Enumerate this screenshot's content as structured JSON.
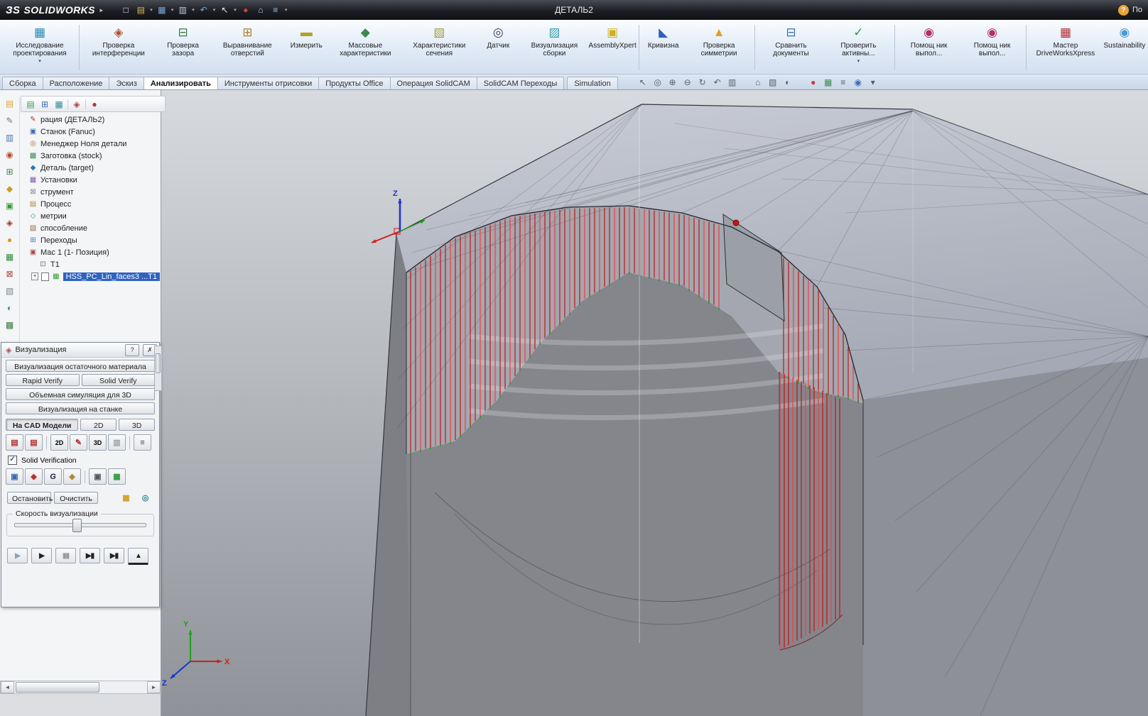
{
  "colors": {
    "selection_blue": "#2f63c0",
    "toolpath_red": "#cc2222",
    "toolpath_green": "#1e9e1e",
    "titlebar_dark": "#1c1e23",
    "ribbon_blue": "#d3e0f0"
  },
  "glyphs": {
    "caret": "▾",
    "logo_caret": "►",
    "question": "?",
    "close": "✗",
    "check": "✓",
    "left": "◄",
    "right": "►",
    "plus": "+"
  },
  "titlebar": {
    "logo_mark": "ЗS",
    "logo_text": "SOLIDWORKS",
    "title": "ДЕТАЛЬ2",
    "right_text": "По",
    "help": "?",
    "icons": [
      {
        "name": "new-document-icon",
        "glyph": "□"
      },
      {
        "name": "open-icon",
        "glyph": "▤"
      },
      {
        "name": "save-icon",
        "glyph": "▦"
      },
      {
        "name": "print-icon",
        "glyph": "▥"
      },
      {
        "name": "undo-icon",
        "glyph": "↶"
      },
      {
        "name": "select-icon",
        "glyph": "↖"
      },
      {
        "name": "rebuild-icon",
        "glyph": "●"
      },
      {
        "name": "home-icon",
        "glyph": "⌂"
      },
      {
        "name": "options-icon",
        "glyph": "≡"
      }
    ]
  },
  "ribbon": {
    "buttons": [
      {
        "label": "Исследование проектирования",
        "icon": "▦",
        "dropdown": true
      },
      {
        "label": "Проверка интерференции",
        "icon": "◈"
      },
      {
        "label": "Проверка зазора",
        "icon": "⊟"
      },
      {
        "label": "Выравнивание отверстий",
        "icon": "⊞"
      },
      {
        "label": "Измерить",
        "icon": "▬"
      },
      {
        "label": "Массовые характеристики",
        "icon": "◆"
      },
      {
        "label": "Характеристики сечения",
        "icon": "▧"
      },
      {
        "label": "Датчик",
        "icon": "◎"
      },
      {
        "label": "Визуализация сборки",
        "icon": "▨"
      },
      {
        "label": "AssemblyXpert",
        "icon": "▣"
      },
      {
        "label": "Кривизна",
        "icon": "◣"
      },
      {
        "label": "Проверка симметрии",
        "icon": "▲"
      },
      {
        "label": "Сравнить документы",
        "icon": "⊟"
      },
      {
        "label": "Проверить активны...",
        "icon": "✓",
        "dropdown": true
      },
      {
        "label": "Помощ ник выпол...",
        "icon": "◉"
      },
      {
        "label": "Помощ ник выпол...",
        "icon": "◉"
      },
      {
        "label": "Мастер DriveWorksXpress",
        "icon": "▦"
      },
      {
        "label": "Sustainability",
        "icon": "◉"
      }
    ]
  },
  "tabs": {
    "items": [
      {
        "label": "Сборка"
      },
      {
        "label": "Расположение"
      },
      {
        "label": "Эскиз"
      },
      {
        "label": "Анализировать",
        "active": true
      },
      {
        "label": "Инструменты отрисовки"
      },
      {
        "label": "Продукты Office"
      },
      {
        "label": "Операция  SolidCAM"
      },
      {
        "label": "SolidCAM Переходы"
      },
      {
        "label": "Simulation"
      }
    ]
  },
  "hud": {
    "icons": [
      {
        "name": "select-icon",
        "glyph": "↖"
      },
      {
        "name": "zoom-fit-icon",
        "glyph": "◎"
      },
      {
        "name": "zoom-in-icon",
        "glyph": "⊕"
      },
      {
        "name": "zoom-out-icon",
        "glyph": "⊖"
      },
      {
        "name": "rotate-view-icon",
        "glyph": "↻"
      },
      {
        "name": "previous-view-icon",
        "glyph": "↶"
      },
      {
        "name": "section-view-icon",
        "glyph": "▥"
      },
      {
        "name": "view-orientation-icon",
        "glyph": "⌂"
      },
      {
        "name": "display-style-icon",
        "glyph": "▧"
      },
      {
        "name": "hide-show-icon",
        "glyph": "◐"
      },
      {
        "name": "appearance-icon",
        "glyph": "●"
      },
      {
        "name": "scene-icon",
        "glyph": "▦"
      },
      {
        "name": "view-settings-icon",
        "glyph": "≡"
      },
      {
        "name": "camera-icon",
        "glyph": "◉"
      },
      {
        "name": "hud-caret-icon",
        "glyph": "▾"
      }
    ]
  },
  "side_strip": {
    "icons": [
      {
        "name": "folder-icon",
        "glyph": "▤"
      },
      {
        "name": "attach-icon",
        "glyph": "✎"
      },
      {
        "name": "views-icon",
        "glyph": "▥"
      },
      {
        "name": "target-icon",
        "glyph": "◉"
      },
      {
        "name": "grid-icon",
        "glyph": "⊞"
      },
      {
        "name": "gem-icon",
        "glyph": "◆"
      },
      {
        "name": "stock-icon",
        "glyph": "▣"
      },
      {
        "name": "fixture-icon",
        "glyph": "◈"
      },
      {
        "name": "ball-icon",
        "glyph": "●"
      },
      {
        "name": "cube-icon",
        "glyph": "▦"
      },
      {
        "name": "delete-icon",
        "glyph": "⊠"
      },
      {
        "name": "hatch-icon",
        "glyph": "▧"
      },
      {
        "name": "contrast-icon",
        "glyph": "◐"
      },
      {
        "name": "pattern-icon",
        "glyph": "▩"
      }
    ]
  },
  "tree": {
    "header_icons": [
      {
        "name": "cam-tree-icon",
        "glyph": "▤"
      },
      {
        "name": "tool-table-icon",
        "glyph": "⊞"
      },
      {
        "name": "operations-icon",
        "glyph": "▦"
      },
      {
        "name": "machine-icon",
        "glyph": "◈"
      },
      {
        "name": "simulate-icon",
        "glyph": "●"
      }
    ],
    "items": [
      {
        "label": "рация (ДЕТАЛЬ2)",
        "glyph": "✎"
      },
      {
        "label": "Станок (Fanuc)",
        "glyph": "▣"
      },
      {
        "label": "Менеджер Ноля детали",
        "glyph": "◎"
      },
      {
        "label": "Заготовка (stock)",
        "glyph": "▩"
      },
      {
        "label": "Деталь (target)",
        "glyph": "◆"
      },
      {
        "label": "Установки",
        "glyph": "▦"
      },
      {
        "label": "струмент",
        "glyph": "⊠"
      },
      {
        "label": "Процесс",
        "glyph": "▤"
      },
      {
        "label": "метрии",
        "glyph": "◇"
      },
      {
        "label": "способление",
        "glyph": "▧"
      },
      {
        "label": "Переходы",
        "glyph": "⊞"
      },
      {
        "label": "Мас 1 (1- Позиция)",
        "glyph": "▣"
      },
      {
        "label": "T1",
        "glyph": "⊡"
      },
      {
        "label": "HSS_PC_Lin_faces3 ...T1",
        "glyph": "▦",
        "selected": true,
        "checkbox": true
      }
    ]
  },
  "viz": {
    "title": "Визуализация",
    "title_icon": "◈",
    "btn_residual": "Визуализация остаточного материала",
    "btn_rapid": "Rapid Verify",
    "btn_solid": "Solid Verify",
    "btn_volume": "Объемная симуляция для 3D",
    "btn_machine": "Визуализация на станке",
    "tab_cad": "На  CAD Модели",
    "tab_2d": "2D",
    "tab_3d": "3D",
    "checkbox_label": "Solid Verification",
    "btn_stop": "Остановить",
    "btn_clear": "Очистить",
    "speed_label": "Скорость визуализации",
    "icons_row1": [
      {
        "name": "show-stock-icon",
        "glyph": "▤"
      },
      {
        "name": "show-target-icon",
        "glyph": "▤"
      },
      {
        "name": "view-2d-icon",
        "glyph": "2D"
      },
      {
        "name": "redraw-icon",
        "glyph": "✎"
      },
      {
        "name": "view-3d-icon",
        "glyph": "3D"
      },
      {
        "name": "print-icon",
        "glyph": "▥"
      },
      {
        "name": "report-icon",
        "glyph": "≡"
      }
    ],
    "icons_row2": [
      {
        "name": "solid-mode-icon",
        "glyph": "▣"
      },
      {
        "name": "quality-icon",
        "glyph": "◆"
      },
      {
        "name": "gouge-check-icon",
        "glyph": "G"
      },
      {
        "name": "flags-icon",
        "glyph": "◈"
      },
      {
        "name": "stock-box-icon",
        "glyph": "▣"
      },
      {
        "name": "compare-icon",
        "glyph": "▦"
      }
    ],
    "stop_icons": [
      {
        "name": "hold-icon",
        "glyph": "▦"
      },
      {
        "name": "gear-icon",
        "glyph": "◎"
      }
    ],
    "media": [
      {
        "name": "step-button",
        "glyph": "▶"
      },
      {
        "name": "play-button",
        "glyph": "▶"
      },
      {
        "name": "pause-button",
        "glyph": "▮▮"
      },
      {
        "name": "next-button",
        "glyph": "▶▮"
      },
      {
        "name": "end-button",
        "glyph": "▶▮"
      },
      {
        "name": "eject-button",
        "glyph": "▲"
      }
    ]
  },
  "viewport": {
    "axes": {
      "x": "X",
      "y": "Y",
      "z": "Z"
    }
  }
}
